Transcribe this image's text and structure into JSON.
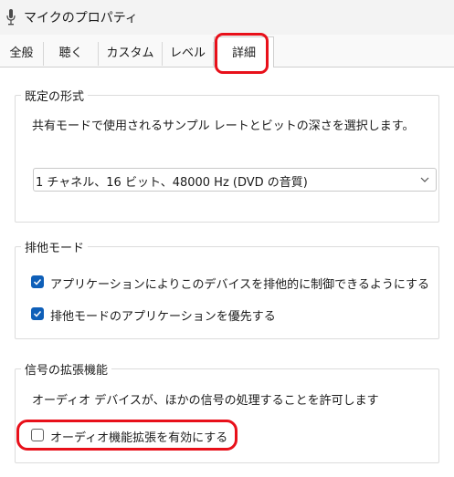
{
  "window": {
    "title": "マイクのプロパティ"
  },
  "tabs": [
    {
      "label": "全般"
    },
    {
      "label": "聴く"
    },
    {
      "label": "カスタム"
    },
    {
      "label": "レベル"
    },
    {
      "label": "詳細",
      "active": true
    }
  ],
  "default_format": {
    "title": "既定の形式",
    "description": "共有モードで使用されるサンプル レートとビットの深さを選択します。",
    "selected": "1 チャネル、16 ビット、48000 Hz (DVD の音質)"
  },
  "exclusive_mode": {
    "title": "排他モード",
    "options": [
      {
        "label": "アプリケーションによりこのデバイスを排他的に制御できるようにする",
        "checked": true
      },
      {
        "label": "排他モードのアプリケーションを優先する",
        "checked": true
      }
    ]
  },
  "signal_enhancements": {
    "title": "信号の拡張機能",
    "description": "オーディオ デバイスが、ほかの信号の処理することを許可します",
    "option": {
      "label": "オーディオ機能拡張を有効にする",
      "checked": false
    }
  },
  "colors": {
    "accent": "#0f5fb8",
    "highlight": "#e8101a"
  }
}
